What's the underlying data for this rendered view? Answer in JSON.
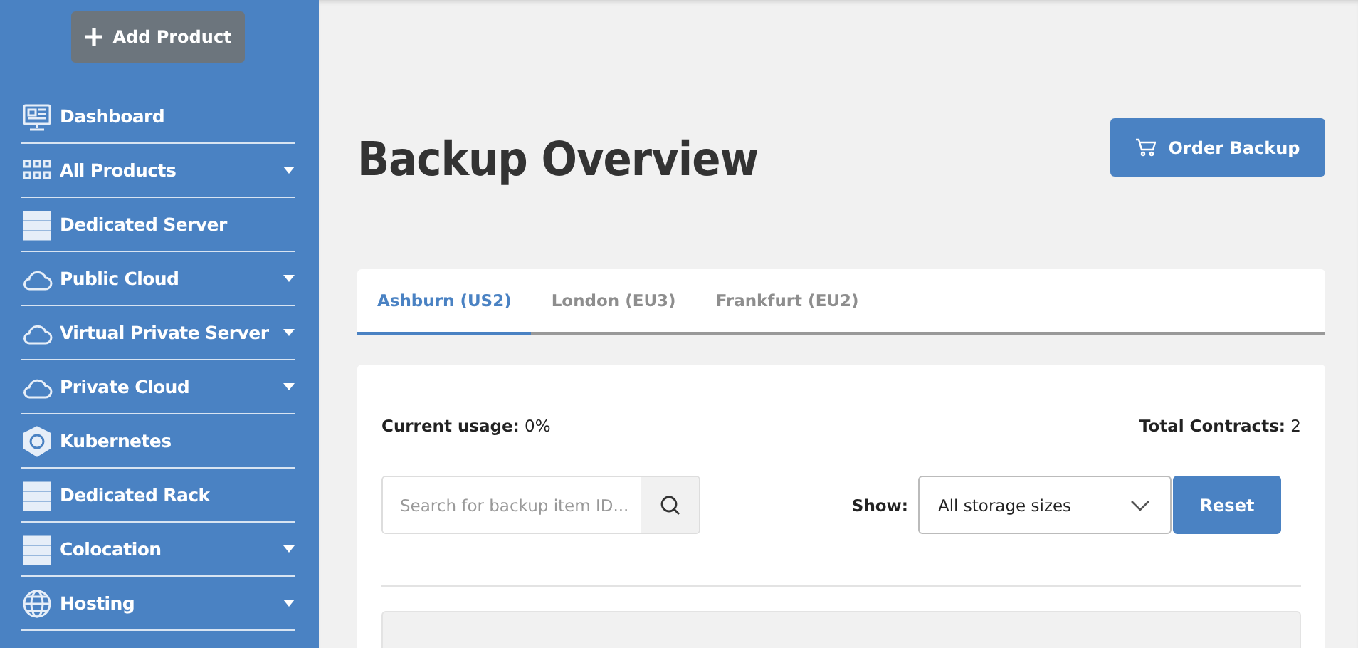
{
  "sidebar": {
    "add_button": "Add Product",
    "items": [
      {
        "label": "Dashboard",
        "expandable": false
      },
      {
        "label": "All Products",
        "expandable": true
      },
      {
        "label": "Dedicated Server",
        "expandable": false
      },
      {
        "label": "Public Cloud",
        "expandable": true
      },
      {
        "label": "Virtual Private Server",
        "expandable": true
      },
      {
        "label": "Private Cloud",
        "expandable": true
      },
      {
        "label": "Kubernetes",
        "expandable": false
      },
      {
        "label": "Dedicated Rack",
        "expandable": false
      },
      {
        "label": "Colocation",
        "expandable": true
      },
      {
        "label": "Hosting",
        "expandable": true
      }
    ]
  },
  "page": {
    "title": "Backup Overview",
    "order_button": "Order Backup"
  },
  "tabs": [
    {
      "label": "Ashburn (US2)",
      "selected": true
    },
    {
      "label": "London (EU3)",
      "selected": false
    },
    {
      "label": "Frankfurt (EU2)",
      "selected": false
    }
  ],
  "summary": {
    "usage_label": "Current usage:",
    "usage_value": "0%",
    "contracts_label": "Total Contracts:",
    "contracts_value": "2"
  },
  "filters": {
    "search_placeholder": "Search for backup item ID...",
    "show_label": "Show:",
    "size_select": "All storage sizes",
    "reset_button": "Reset"
  }
}
